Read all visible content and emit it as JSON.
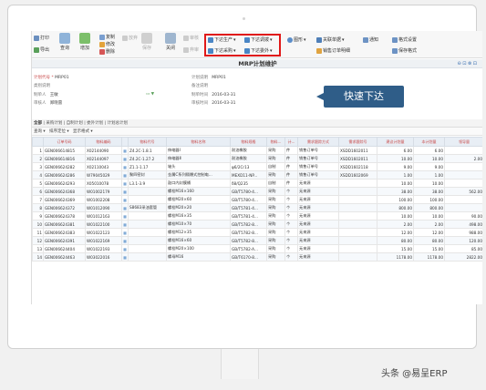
{
  "toolbar": {
    "print": "打印",
    "export": "导出",
    "query": "查询",
    "add": "增加",
    "copy": "复制",
    "edit": "修改",
    "delete": "删除",
    "abandon": "放弃",
    "save": "保存",
    "close": "关闭",
    "audit": "审核",
    "unaudit": "弃审",
    "push_production": "下达生产",
    "push_outsourcing": "下达委外",
    "push_purchase": "下达采购",
    "push_transfer": "下达调拨",
    "chart": "图形",
    "related": "关联单据",
    "sales_order_detail": "销售订单明细",
    "notify": "通知",
    "format_settings": "格式设置",
    "save_format": "保存格式"
  },
  "window": {
    "title": "MRP计划维护",
    "controls": "⊖ ⊡ ⊗ ⊡"
  },
  "form": {
    "plan_no_label": "计划代号",
    "plan_no": "MRP01",
    "scope_label": "类别说明",
    "maker_label": "制单人",
    "maker": "王敏",
    "auditor_label": "审核人",
    "auditor": "郑晓雷",
    "plan_desc_label": "计划说明",
    "plan_desc": "MRP01",
    "remark_label": "备注说明",
    "make_time_label": "制单时间",
    "make_time": "2016-03-31",
    "audit_time_label": "审核时间",
    "audit_time": "2016-03-31"
  },
  "callout": "快速下达",
  "tabs": [
    "全部",
    "采购计划",
    "自制计划",
    "委外计划",
    "计划总计划"
  ],
  "subbar": {
    "query": "查询 ▾",
    "sort": "排序定位 ▾",
    "display": "显示格式 ▾"
  },
  "columns": [
    "",
    "订单号码",
    "物料编码",
    "",
    "物料代号",
    "物料名称",
    "物料规格",
    "物料...",
    "计...",
    "需求跟踪方式",
    "需求跟踪号",
    "建议计划量",
    "本计划量",
    "领导量"
  ],
  "rows": [
    [
      "1",
      "GEN006614815",
      "X02144090",
      "▦",
      "Z4.2C-1.8.1",
      "伸缩器Ⅰ",
      "耐油橡胶",
      "采购",
      "件",
      "销售订单号",
      "XSDD1602011",
      "6.00",
      "6.00",
      ""
    ],
    [
      "2",
      "GEN006614816",
      "X02144097",
      "▦",
      "Z4.2C-1.27.2",
      "伸缩器Ⅱ",
      "耐油橡胶",
      "采购",
      "件",
      "销售订单号",
      "XSDD1602011",
      "10.00",
      "10.00",
      "2.00"
    ],
    [
      "3",
      "GEN006624282",
      "X02110043",
      "▦",
      "Z1.1-1.17",
      "轴头",
      "φ6/2Cr13",
      "自制",
      "件",
      "销售订单号",
      "XSDD1602118",
      "9.00",
      "9.00",
      ""
    ],
    [
      "4",
      "GEN006624286",
      "W79045029",
      "▦",
      "聚四密封",
      "金属C系列隔爆式控制电...",
      "MEXD11-NP...",
      "采购",
      "件",
      "销售订单号",
      "XSDD1602069",
      "1.00",
      "1.00",
      ""
    ],
    [
      "5",
      "GEN006624293",
      "X05010078",
      "▦",
      "L3.1-3.9",
      "鼓口内封膜桶",
      "δ8/Q235",
      "自制",
      "件",
      "无来源",
      "",
      "10.00",
      "10.00",
      ""
    ],
    [
      "6",
      "GEN006624368",
      "W01002179",
      "▦",
      "",
      "螺栓M16×160",
      "GB/T5780-4...",
      "采购",
      "个",
      "无来源",
      "",
      "38.00",
      "38.00",
      "562.00"
    ],
    [
      "7",
      "GEN006624369",
      "W01002208",
      "▦",
      "",
      "螺栓M20×60",
      "GB/T5780-4...",
      "采购",
      "个",
      "无来源",
      "",
      "100.00",
      "100.00",
      ""
    ],
    [
      "8",
      "GEN006624372",
      "W01012090",
      "▦",
      "S8683采油套管",
      "螺栓M20×20",
      "GB/T5781-4...",
      "采购",
      "个",
      "无来源",
      "",
      "800.00",
      "800.00",
      ""
    ],
    [
      "9",
      "GEN006624378",
      "W01012163",
      "▦",
      "",
      "螺栓M16×35",
      "GB/T5781-4...",
      "采购",
      "个",
      "无来源",
      "",
      "10.00",
      "10.00",
      "90.00"
    ],
    [
      "10",
      "GEN006624381",
      "W01022100",
      "▦",
      "",
      "螺栓M10×70",
      "GB/T5782-8...",
      "采购",
      "个",
      "无来源",
      "",
      "2.00",
      "2.00",
      "498.00"
    ],
    [
      "11",
      "GEN006624383",
      "W01022123",
      "▦",
      "",
      "螺栓M12×35",
      "GB/T5782-8...",
      "采购",
      "个",
      "无来源",
      "",
      "12.00",
      "12.00",
      "988.00"
    ],
    [
      "12",
      "GEN006624391",
      "W01022169",
      "▦",
      "",
      "螺栓M16×60",
      "GB/T5782-8...",
      "采购",
      "个",
      "无来源",
      "",
      "80.00",
      "80.00",
      "120.00"
    ],
    [
      "13",
      "GEN006624404",
      "W01022193",
      "▦",
      "",
      "螺栓M20×100",
      "GB/T5782-A...",
      "采购",
      "个",
      "无来源",
      "",
      "15.00",
      "15.00",
      "85.00"
    ],
    [
      "14",
      "GEN006624463",
      "W03022016",
      "▦",
      "",
      "螺母M16",
      "GB/T6170-8...",
      "采购",
      "个",
      "无来源",
      "",
      "1178.00",
      "1178.00",
      "2822.00"
    ]
  ],
  "watermark": "头条 @易呈ERP",
  "colors": {
    "highlight": "#e01818",
    "callout": "#2f5d88",
    "label": "#c84a4a"
  }
}
